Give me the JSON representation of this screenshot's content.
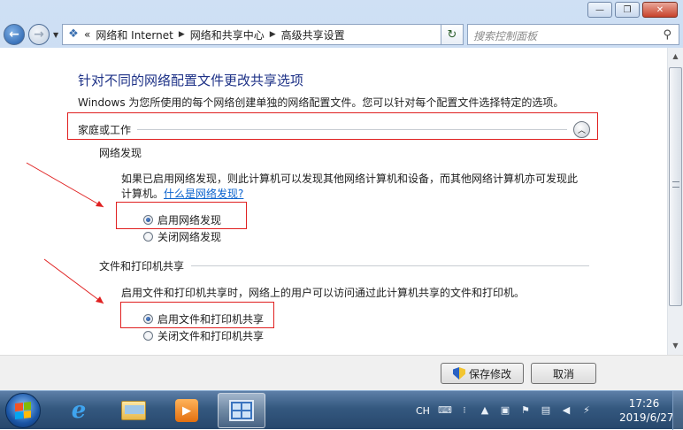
{
  "window": {
    "minimize": "—",
    "maximize": "❐",
    "close": "✕"
  },
  "address": {
    "prefix": "«",
    "crumbs": [
      "网络和 Internet",
      "网络和共享中心",
      "高级共享设置"
    ]
  },
  "search": {
    "placeholder": "搜索控制面板"
  },
  "content": {
    "title": "针对不同的网络配置文件更改共享选项",
    "description": "Windows 为您所使用的每个网络创建单独的网络配置文件。您可以针对每个配置文件选择特定的选项。",
    "profile_header": "家庭或工作",
    "network_discovery": {
      "heading": "网络发现",
      "desc_line1": "如果已启用网络发现，则此计算机可以发现其他网络计算机和设备，而其他网络计算机亦可发现此",
      "desc_line2": "计算机。",
      "link": "什么是网络发现?",
      "option_on": "启用网络发现",
      "option_off": "关闭网络发现",
      "selected": "on"
    },
    "file_printer_sharing": {
      "heading": "文件和打印机共享",
      "desc": "启用文件和打印机共享时，网络上的用户可以访问通过此计算机共享的文件和打印机。",
      "option_on": "启用文件和打印机共享",
      "option_off": "关闭文件和打印机共享",
      "selected": "on"
    }
  },
  "buttons": {
    "save": "保存修改",
    "cancel": "取消"
  },
  "taskbar": {
    "tray_lang": "CH",
    "time": "17:26",
    "date": "2019/6/27"
  },
  "colors": {
    "highlight_box": "#e02020",
    "title": "#1e3287",
    "link": "#0b63ce"
  }
}
